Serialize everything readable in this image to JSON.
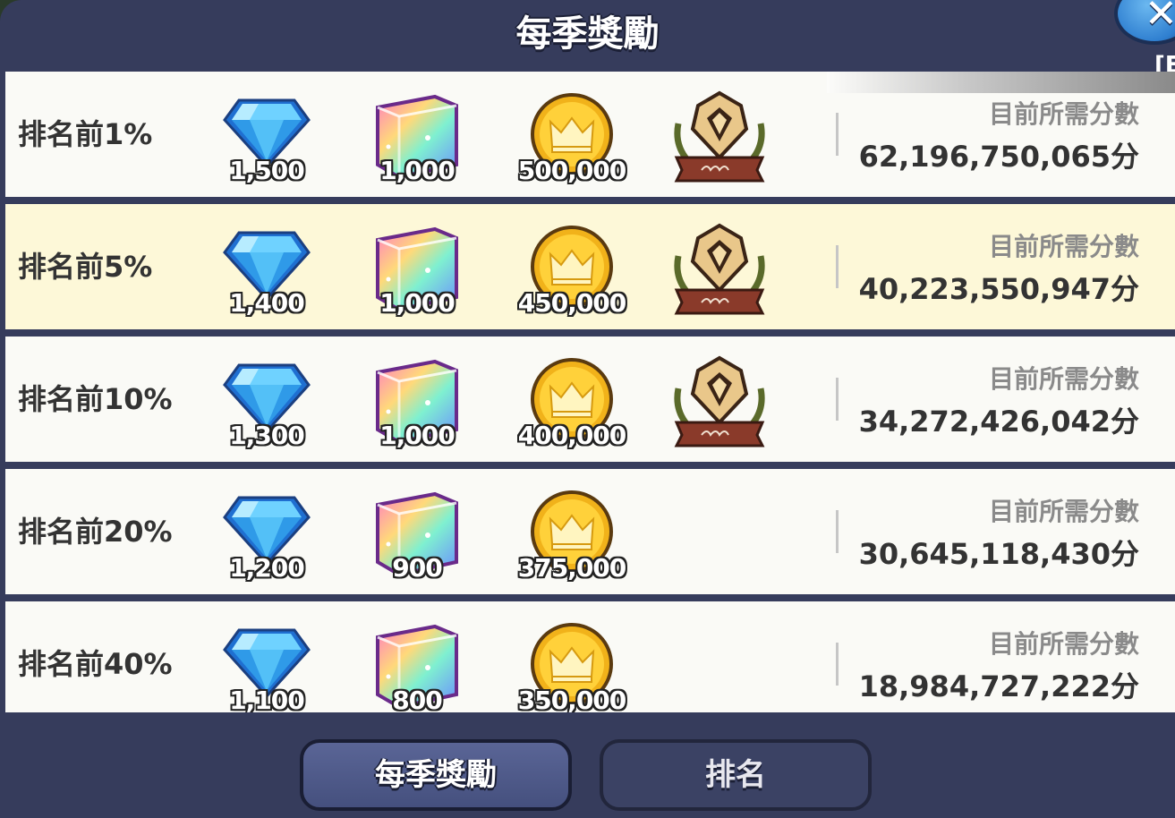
{
  "title": "每季獎勵",
  "close_icon_glyph": "✕",
  "edge_label": "[E",
  "req_label": "目前所需分數",
  "rows": [
    {
      "rank": "排名前1%",
      "gems": "1,500",
      "cubes": "1,000",
      "coins": "500,000",
      "badge": true,
      "score": "62,196,750,065分",
      "highlight": false
    },
    {
      "rank": "排名前5%",
      "gems": "1,400",
      "cubes": "1,000",
      "coins": "450,000",
      "badge": true,
      "score": "40,223,550,947分",
      "highlight": true
    },
    {
      "rank": "排名前10%",
      "gems": "1,300",
      "cubes": "1,000",
      "coins": "400,000",
      "badge": true,
      "score": "34,272,426,042分",
      "highlight": false
    },
    {
      "rank": "排名前20%",
      "gems": "1,200",
      "cubes": "900",
      "coins": "375,000",
      "badge": false,
      "score": "30,645,118,430分",
      "highlight": false
    },
    {
      "rank": "排名前40%",
      "gems": "1,100",
      "cubes": "800",
      "coins": "350,000",
      "badge": false,
      "score": "18,984,727,222分",
      "highlight": false
    }
  ],
  "tabs": {
    "season_rewards": "每季獎勵",
    "ranking": "排名"
  },
  "colors": {
    "panel": "#363c5c",
    "row": "#fafaf6",
    "row_highlight": "#fdf8d8",
    "close_button": "#2f7fd0"
  },
  "icons": [
    "diamond-icon",
    "rainbow-cube-icon",
    "crown-coin-icon",
    "laurel-badge-icon",
    "close-icon"
  ]
}
